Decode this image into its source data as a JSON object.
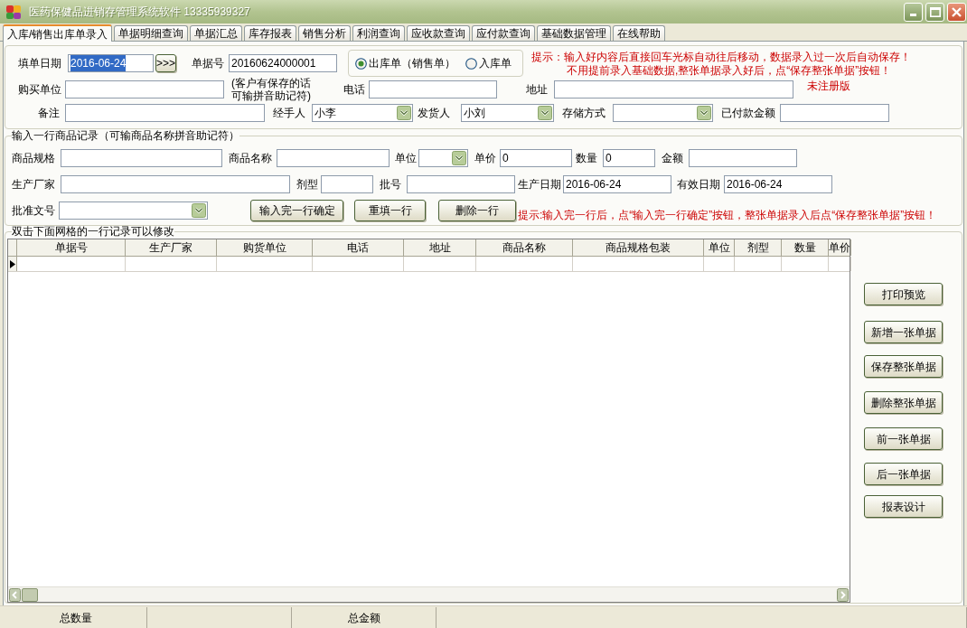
{
  "window": {
    "title": "医药保健品进销存管理系统软件 13335939327"
  },
  "tabs": [
    {
      "label": "入库/销售出库单录入",
      "selected": true
    },
    {
      "label": "单据明细查询",
      "selected": false
    },
    {
      "label": "单据汇总",
      "selected": false
    },
    {
      "label": "库存报表",
      "selected": false
    },
    {
      "label": "销售分析",
      "selected": false
    },
    {
      "label": "利润查询",
      "selected": false
    },
    {
      "label": "应收款查询",
      "selected": false
    },
    {
      "label": "应付款查询",
      "selected": false
    },
    {
      "label": "基础数据管理",
      "selected": false
    },
    {
      "label": "在线帮助",
      "selected": false
    }
  ],
  "order_form": {
    "date": {
      "label": "填单日期",
      "value": "2016-06-24",
      "text_selected": true,
      "button": ">>>"
    },
    "order_no": {
      "label": "单据号",
      "value": "20160624000001"
    },
    "order_type": [
      {
        "label": "出库单（销售单）",
        "selected": true
      },
      {
        "label": "入库单",
        "selected": false
      }
    ],
    "tips": [
      "提示：输入好内容后直接回车光标自动往后移动，数据录入过一次后自动保存！",
      "不用提前录入基础数据,整张单据录入好后，点“保存整张单据”按钮！"
    ],
    "buyer": {
      "label": "购买单位"
    },
    "buyer_hint": [
      "(客户有保存的话",
      "可输拼音助记符)"
    ],
    "phone": {
      "label": "电话"
    },
    "address": {
      "label": "地址"
    },
    "edition": "未注册版",
    "remark": {
      "label": "备注"
    },
    "handler": {
      "label": "经手人",
      "value": "小李"
    },
    "shipper": {
      "label": "发货人",
      "value": "小刘"
    },
    "storage": {
      "label": "存储方式"
    },
    "paid": {
      "label": "已付款金额"
    }
  },
  "item_form": {
    "title": "输入一行商品记录（可输商品名称拼音助记符）",
    "spec": {
      "label": "商品规格"
    },
    "name": {
      "label": "商品名称"
    },
    "unit": {
      "label": "单位"
    },
    "price": {
      "label": "单价",
      "value": "0"
    },
    "quantity": {
      "label": "数量",
      "value": "0"
    },
    "amount": {
      "label": "金额"
    },
    "maker": {
      "label": "生产厂家"
    },
    "dosage_form": {
      "label": "剂型"
    },
    "batch": {
      "label": "批号"
    },
    "production_date": {
      "label": "生产日期",
      "value": "2016-06-24"
    },
    "expiry_date": {
      "label": "有效日期",
      "value": "2016-06-24"
    },
    "approval_no": {
      "label": "批准文号"
    },
    "buttons": [
      "输入完一行确定",
      "重填一行",
      "删除一行"
    ],
    "tip": "提示:输入完一行后，点“输入完一行确定”按钮，整张单据录入后点“保存整张单据”按钮！"
  },
  "grid": {
    "title": "双击下面网格的一行记录可以修改",
    "columns": [
      "单据号",
      "生产厂家",
      "购货单位",
      "电话",
      "地址",
      "商品名称",
      "商品规格包装",
      "单位",
      "剂型",
      "数量",
      "单价"
    ]
  },
  "side_buttons": [
    "打印预览",
    "新增一张单据",
    "保存整张单据",
    "删除整张单据",
    "前一张单据",
    "后一张单据",
    "报表设计"
  ],
  "status_bar": [
    "总数量",
    "总金额"
  ]
}
